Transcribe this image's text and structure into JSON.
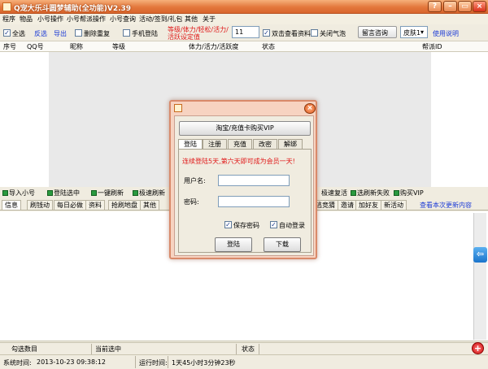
{
  "window": {
    "title": "Q宠大乐斗圆梦辅助(全功能)V2.39"
  },
  "menu": [
    "程序",
    "物品",
    "小号操作",
    "小号帮派操作",
    "小号查询",
    "活动/签到/礼包",
    "其他",
    "关于"
  ],
  "toolbar": {
    "select_all": "全选",
    "invert": "反选",
    "export": "导出",
    "dedupe": "删除重复",
    "phone_login": "手机登陆",
    "settings_line1": "等级/体力/轻松/活力/",
    "settings_line2": "活跃设定值",
    "value": "11",
    "dblclick_view": "双击查看资料",
    "close_bubble": "关闭气泡",
    "feedback": "留言咨询",
    "skin": "皮肤1",
    "help": "使用说明"
  },
  "grid_columns": [
    "序号",
    "QQ号",
    "昵称",
    "等级",
    "体力/活力/活跃度",
    "状态",
    "帮派ID"
  ],
  "actions": [
    "导入小号",
    "登陆选中",
    "一键刷新",
    "极速刷新",
    "极速复活",
    "选刷新失败",
    "购买VIP"
  ],
  "tabs": [
    "信息",
    "刷钱动",
    "每日必做",
    "资料",
    "抢刷地盘",
    "其他"
  ],
  "tabs_right": [
    "逃竞猜",
    "邀请",
    "加好友",
    "新活动"
  ],
  "update_link": "查看本次更新内容",
  "infobar": {
    "selected_count": "勾选数目",
    "current_selected": "当前选中",
    "status": "状态"
  },
  "statusbar": {
    "sys_time_label": "系统时间:",
    "sys_time": "2013-10-23  09:38:12",
    "run_time_label": "运行时间:",
    "run_time": "1天45小时3分钟23秒"
  },
  "dialog": {
    "vip_button": "淘宝/充值卡购买VIP",
    "tabs": [
      "登陆",
      "注册",
      "充值",
      "改密",
      "解绑"
    ],
    "notice": "连续登陆5天,第六天即可成为会员一天!",
    "username_label": "用户名:",
    "password_label": "密码:",
    "save_password": "保存密码",
    "auto_login": "自动登录",
    "login_button": "登陆",
    "download_button": "下载"
  },
  "colors": {
    "titlebar": "#e3773c",
    "accent_link": "#1c3bd6",
    "warning_text": "#e01818",
    "dialog_frame": "#f7d3c1"
  },
  "icons": [
    "app-icon",
    "minimize-icon",
    "maximize-icon",
    "close-icon",
    "help-icon",
    "arrow-left-icon",
    "plus-icon"
  ]
}
